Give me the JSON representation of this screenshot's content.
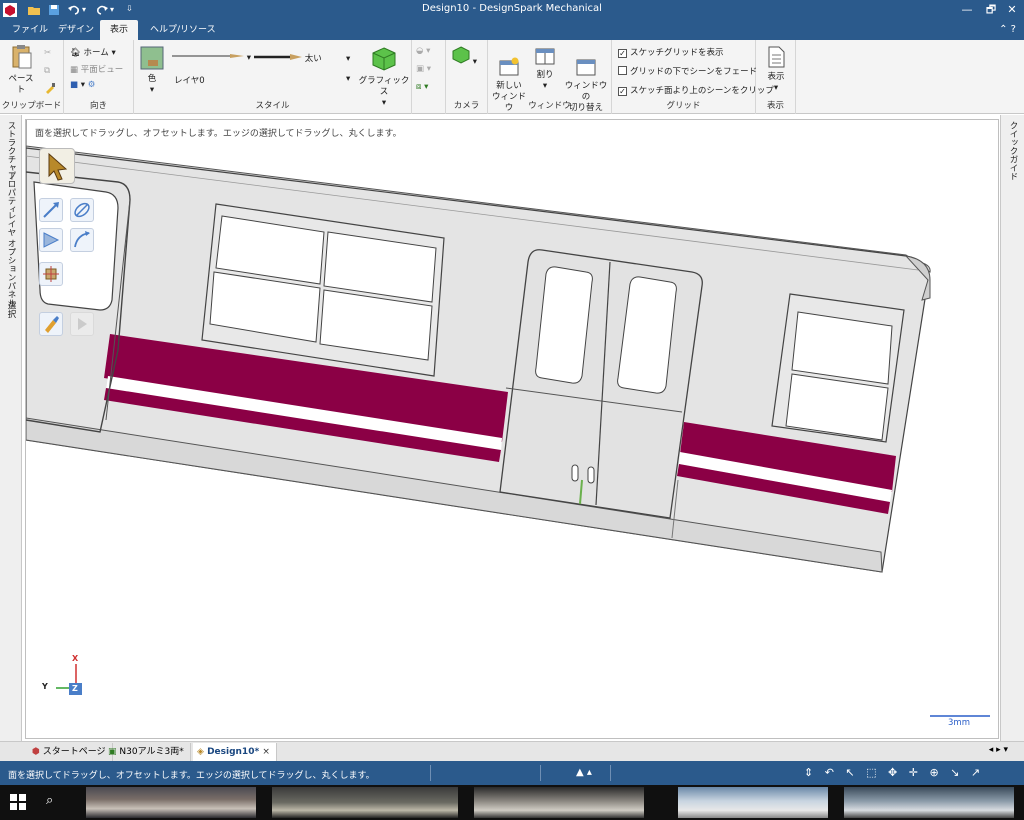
{
  "window": {
    "title": "Design10 - DesignSpark Mechanical",
    "controls": [
      "—",
      "🗗",
      "✕"
    ]
  },
  "menu": {
    "tabs": [
      {
        "label": "ファイル"
      },
      {
        "label": "デザイン"
      },
      {
        "label": "表示",
        "active": true
      },
      {
        "label": "ヘルプ/リソース"
      }
    ],
    "help_glyph": "⌃ ?"
  },
  "ribbon": {
    "clipboard": {
      "paste_label": "ペースト",
      "group_label": "クリップボード"
    },
    "orient": {
      "home_label": "ホーム",
      "plan_view_label": "平面ビュー",
      "group_label": "向き"
    },
    "style": {
      "color_label": "色",
      "layer_label": "レイヤ0",
      "line_weight_label": "太い",
      "graphics_label": "グラフィックス",
      "group_label": "スタイル"
    },
    "camera": {
      "group_label": "カメラ"
    },
    "window": {
      "new_window_label": "新しい\nウィンドウ",
      "split_label": "割り",
      "switch_window_label": "ウィンドウの\n切り替え",
      "group_label": "ウィンドウ"
    },
    "grid": {
      "show_sketch_grid": {
        "label": "スケッチグリッドを表示",
        "checked": true
      },
      "fade_scene": {
        "label": "グリッドの下でシーンをフェード",
        "checked": false
      },
      "clip_scene": {
        "label": "スケッチ面より上のシーンをクリップ",
        "checked": true
      },
      "group_label": "グリッド"
    },
    "show": {
      "show_label": "表示",
      "group_label": "表示"
    }
  },
  "left_panel_tabs": [
    "ストラクチャー",
    "プロパティ",
    "レイヤ",
    "オプションパネル",
    "選択"
  ],
  "right_panel_tabs": [
    "クイックガイド"
  ],
  "canvas": {
    "hint": "面を選択してドラッグし、オフセットします。エッジの選択してドラッグし、丸くします。",
    "scale_label": "3mm",
    "triad": {
      "x": "X",
      "y": "Y",
      "z": "Z"
    },
    "colors": {
      "stripe": "#8b0045",
      "body": "#e4e4e4"
    }
  },
  "doc_tabs": [
    {
      "label": "スタートページ"
    },
    {
      "label": "N30アルミ3両*"
    },
    {
      "label": "Design10*",
      "active": true
    }
  ],
  "status": {
    "text": "面を選択してドラッグし、オフセットします。エッジの選択してドラッグし、丸くします。"
  }
}
